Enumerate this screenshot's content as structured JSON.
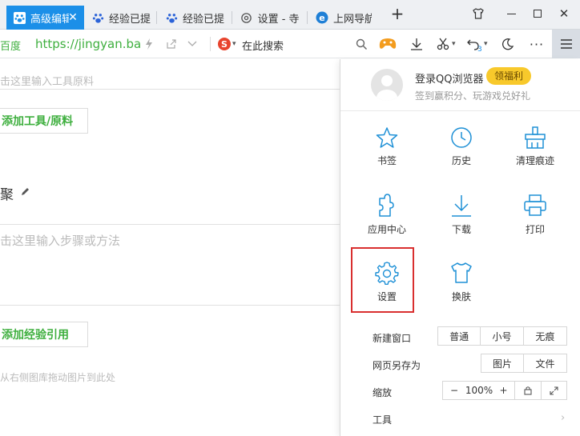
{
  "tabs": [
    {
      "label": "高级编辑",
      "icon": "baidu-paw-icon"
    },
    {
      "label": "经验已提",
      "icon": "baidu-paw-icon"
    },
    {
      "label": "经验已提",
      "icon": "baidu-paw-icon"
    },
    {
      "label": "设置 - 寺",
      "icon": "gear-icon"
    },
    {
      "label": "上网导航",
      "icon": "ie-icon"
    }
  ],
  "toolbar": {
    "site_label": "百度",
    "url": "https://jingyan.ba",
    "search_engine_label": "在此搜索",
    "badge": "3"
  },
  "page": {
    "tool_placeholder": "击这里输入工具原料",
    "add_tool_button": "添加工具/原料",
    "steps_heading": "聚",
    "step_placeholder": "击这里输入步骤或方法",
    "add_ref_button": "添加经验引用",
    "image_hint": "从右侧图库拖动图片到此处"
  },
  "menu": {
    "login_title": "登录QQ浏览器",
    "welfare_label": "领福利",
    "login_sub": "签到赢积分、玩游戏兑好礼",
    "grid": [
      {
        "label": "书签",
        "icon": "star-icon"
      },
      {
        "label": "历史",
        "icon": "clock-icon"
      },
      {
        "label": "清理痕迹",
        "icon": "broom-icon"
      },
      {
        "label": "应用中心",
        "icon": "puzzle-icon"
      },
      {
        "label": "下载",
        "icon": "download-icon"
      },
      {
        "label": "打印",
        "icon": "printer-icon"
      },
      {
        "label": "设置",
        "icon": "gear-icon"
      },
      {
        "label": "换肤",
        "icon": "tshirt-icon"
      }
    ],
    "new_window_label": "新建窗口",
    "new_window_options": [
      "普通",
      "小号",
      "无痕"
    ],
    "save_as_label": "网页另存为",
    "save_as_options": [
      "图片",
      "文件"
    ],
    "zoom_label": "缩放",
    "zoom_minus": "−",
    "zoom_value": "100%",
    "zoom_plus": "+",
    "tools_label": "工具"
  },
  "colors": {
    "accent": "#1b8fe8",
    "icon_blue": "#1e90d6",
    "green": "#3eaf3e",
    "highlight_red": "#d92f2f",
    "welfare": "#f8c92b"
  }
}
